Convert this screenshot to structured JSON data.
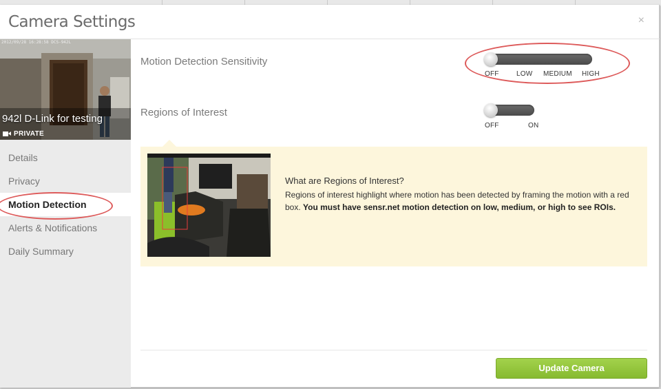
{
  "dialog": {
    "title": "Camera Settings",
    "close_glyph": "×"
  },
  "camera": {
    "name": "942l D-Link for testing",
    "privacy_badge": "PRIVATE",
    "timestamp_overlay": "2012/09/28 16:28:58 DCS-942L"
  },
  "sidebar": {
    "items": [
      {
        "label": "Details",
        "active": false
      },
      {
        "label": "Privacy",
        "active": false
      },
      {
        "label": "Motion Detection",
        "active": true
      },
      {
        "label": "Alerts & Notifications",
        "active": false
      },
      {
        "label": "Daily Summary",
        "active": false
      }
    ]
  },
  "settings": {
    "sensitivity": {
      "label": "Motion Detection Sensitivity",
      "options": [
        "OFF",
        "LOW",
        "MEDIUM",
        "HIGH"
      ],
      "selected": "OFF"
    },
    "roi": {
      "label": "Regions of Interest",
      "options": [
        "OFF",
        "ON"
      ],
      "selected": "OFF"
    }
  },
  "info": {
    "title": "What are Regions of Interest?",
    "text": "Regions of interest highlight where motion has been detected by framing the motion with a red box. ",
    "text_bold": "You must have sensr.net motion detection on low, medium, or high to see ROIs."
  },
  "footer": {
    "update_button": "Update Camera"
  },
  "colors": {
    "accent_green": "#8dc13a",
    "annotation_red": "#dd5a5a",
    "info_bg": "#fdf6dc"
  }
}
